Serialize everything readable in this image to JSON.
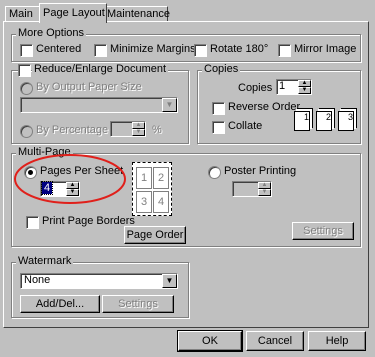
{
  "tabs": [
    {
      "label": "Main"
    },
    {
      "label": "Page Layout"
    },
    {
      "label": "Maintenance"
    }
  ],
  "more_options": {
    "title": "More Options",
    "centered": "Centered",
    "minimize_margins": "Minimize Margins",
    "rotate_180": "Rotate 180°",
    "mirror_image": "Mirror Image"
  },
  "reduce_enlarge": {
    "title": "Reduce/Enlarge Document",
    "by_output_paper_size": "By Output Paper Size",
    "by_percentage": "By Percentage",
    "percent_sign": "%"
  },
  "copies": {
    "title": "Copies",
    "copies_label": "Copies",
    "copies_value": "1",
    "reverse_order": "Reverse Order",
    "collate": "Collate",
    "collate_icons": [
      "1",
      "2",
      "3"
    ]
  },
  "multi_page": {
    "title": "Multi-Page",
    "pages_per_sheet": "Pages Per Sheet",
    "pages_value": "4",
    "poster_printing": "Poster Printing",
    "print_page_borders": "Print Page Borders",
    "page_order": "Page Order",
    "settings": "Settings",
    "preview_numbers": [
      "1",
      "2",
      "3",
      "4"
    ]
  },
  "watermark": {
    "title": "Watermark",
    "selected": "None",
    "add_del": "Add/Del...",
    "settings": "Settings"
  },
  "footer": {
    "ok": "OK",
    "cancel": "Cancel",
    "help": "Help"
  },
  "colors": {
    "face": "#c0c0c0",
    "highlight_circle": "#e0201b",
    "selection": "#000080"
  }
}
